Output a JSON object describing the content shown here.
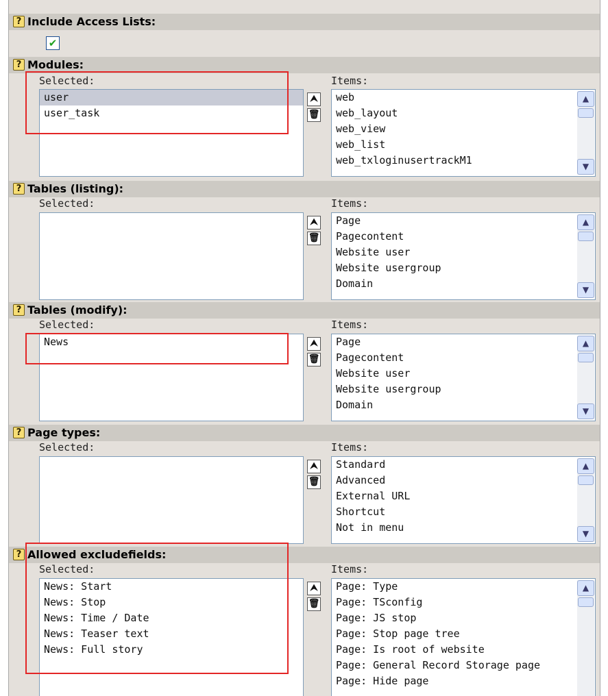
{
  "include_access": {
    "label": "Include Access Lists:",
    "checked": true,
    "check_glyph": "✔"
  },
  "help_glyph": "?",
  "icons": {
    "move_top": "⮝",
    "delete": "🗑",
    "scroll_up": "▲",
    "scroll_down": "▼"
  },
  "captions": {
    "selected": "Selected:",
    "items": "Items:"
  },
  "modules": {
    "label": "Modules:",
    "selected": [
      "user",
      "user_task"
    ],
    "highlighted": "user",
    "items": [
      "web",
      "web_layout",
      "web_view",
      "web_list",
      "web_txloginusertrackM1"
    ]
  },
  "tables_listing": {
    "label": "Tables (listing):",
    "selected": [],
    "items": [
      "Page",
      "Pagecontent",
      "Website user",
      "Website usergroup",
      "Domain"
    ]
  },
  "tables_modify": {
    "label": "Tables (modify):",
    "selected": [
      "News"
    ],
    "items": [
      "Page",
      "Pagecontent",
      "Website user",
      "Website usergroup",
      "Domain"
    ]
  },
  "page_types": {
    "label": "Page types:",
    "selected": [],
    "items": [
      "Standard",
      "Advanced",
      "External URL",
      "Shortcut",
      "Not in menu"
    ]
  },
  "allowed_excludefields": {
    "label": "Allowed excludefields:",
    "selected": [
      "News: Start",
      "News: Stop",
      "News: Time / Date",
      "News: Teaser text",
      "News: Full story"
    ],
    "items": [
      "Page: Type",
      "Page: TSconfig",
      "Page: JS stop",
      "Page: Stop page tree",
      "Page: Is root of website",
      "Page: General Record Storage page",
      "Page: Hide page"
    ]
  }
}
